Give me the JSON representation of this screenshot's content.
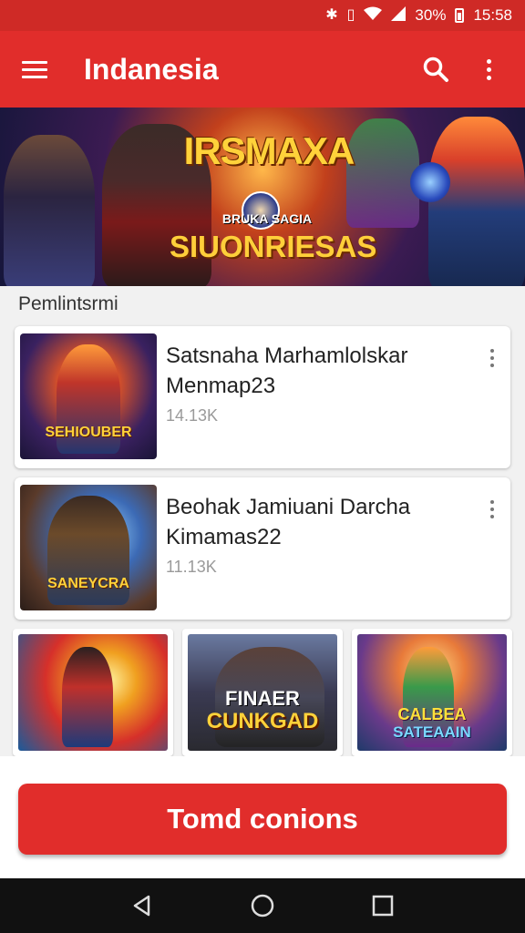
{
  "status_bar": {
    "battery": "30%",
    "time": "15:58",
    "icons": [
      "bluetooth-icon",
      "vibrate-icon",
      "wifi-icon",
      "signal-icon",
      "battery-icon"
    ]
  },
  "app_bar": {
    "title": "Indanesia",
    "icons": [
      "menu-icon",
      "search-icon",
      "more-vert-icon"
    ]
  },
  "banner": {
    "title": "IRSMAXA",
    "subtitle_small": "BRUKA SAGIA",
    "subtitle_large": "SIUONRIESAS"
  },
  "section": {
    "label": "Pemlintsrmi"
  },
  "list": [
    {
      "title": "Satsnaha Marhamlolskar Menmap23",
      "meta": "14.13K",
      "thumb_label": "SEHIOUBER"
    },
    {
      "title": "Beohak Jamiuani Darcha Kimamas22",
      "meta": "11.13K",
      "thumb_label": "SANEYCRA"
    }
  ],
  "grid": [
    {
      "line1": "",
      "line2": ""
    },
    {
      "line1": "FINAER",
      "line2": "CUNKGAD"
    },
    {
      "line1": "CALBEA",
      "line2": "SATEAAIN"
    }
  ],
  "cta": {
    "label": "Tomd conions"
  },
  "colors": {
    "primary": "#e12d2b",
    "status": "#cf2a26",
    "background": "#f1f1f1",
    "nav": "#111111"
  }
}
